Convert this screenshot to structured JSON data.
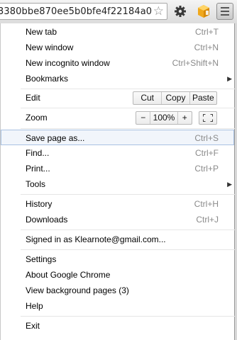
{
  "toolbar": {
    "url": "3380bbe870ee5b0bfe4f22184a0",
    "star_icon": "star-icon",
    "settings_icon": "gear-icon",
    "extension_icon": "extension-icon",
    "menu_icon": "menu-icon"
  },
  "menu": {
    "new_tab": {
      "label": "New tab",
      "shortcut": "Ctrl+T"
    },
    "new_window": {
      "label": "New window",
      "shortcut": "Ctrl+N"
    },
    "new_incognito": {
      "label": "New incognito window",
      "shortcut": "Ctrl+Shift+N"
    },
    "bookmarks": {
      "label": "Bookmarks"
    },
    "edit": {
      "label": "Edit",
      "cut": "Cut",
      "copy": "Copy",
      "paste": "Paste"
    },
    "zoom": {
      "label": "Zoom",
      "minus": "−",
      "value": "100%",
      "plus": "+"
    },
    "save_page": {
      "label": "Save page as...",
      "shortcut": "Ctrl+S"
    },
    "find": {
      "label": "Find...",
      "shortcut": "Ctrl+F"
    },
    "print": {
      "label": "Print...",
      "shortcut": "Ctrl+P"
    },
    "tools": {
      "label": "Tools"
    },
    "history": {
      "label": "History",
      "shortcut": "Ctrl+H"
    },
    "downloads": {
      "label": "Downloads",
      "shortcut": "Ctrl+J"
    },
    "signed_in": {
      "label": "Signed in as Klearnote@gmail.com..."
    },
    "settings": {
      "label": "Settings"
    },
    "about": {
      "label": "About Google Chrome"
    },
    "background_pages": {
      "label": "View background pages (3)"
    },
    "help": {
      "label": "Help"
    },
    "exit": {
      "label": "Exit"
    }
  },
  "colors": {
    "highlight_bg": "#f1f5fb",
    "highlight_border": "#a8c1e2",
    "shortcut_text": "#8a8a8a"
  }
}
